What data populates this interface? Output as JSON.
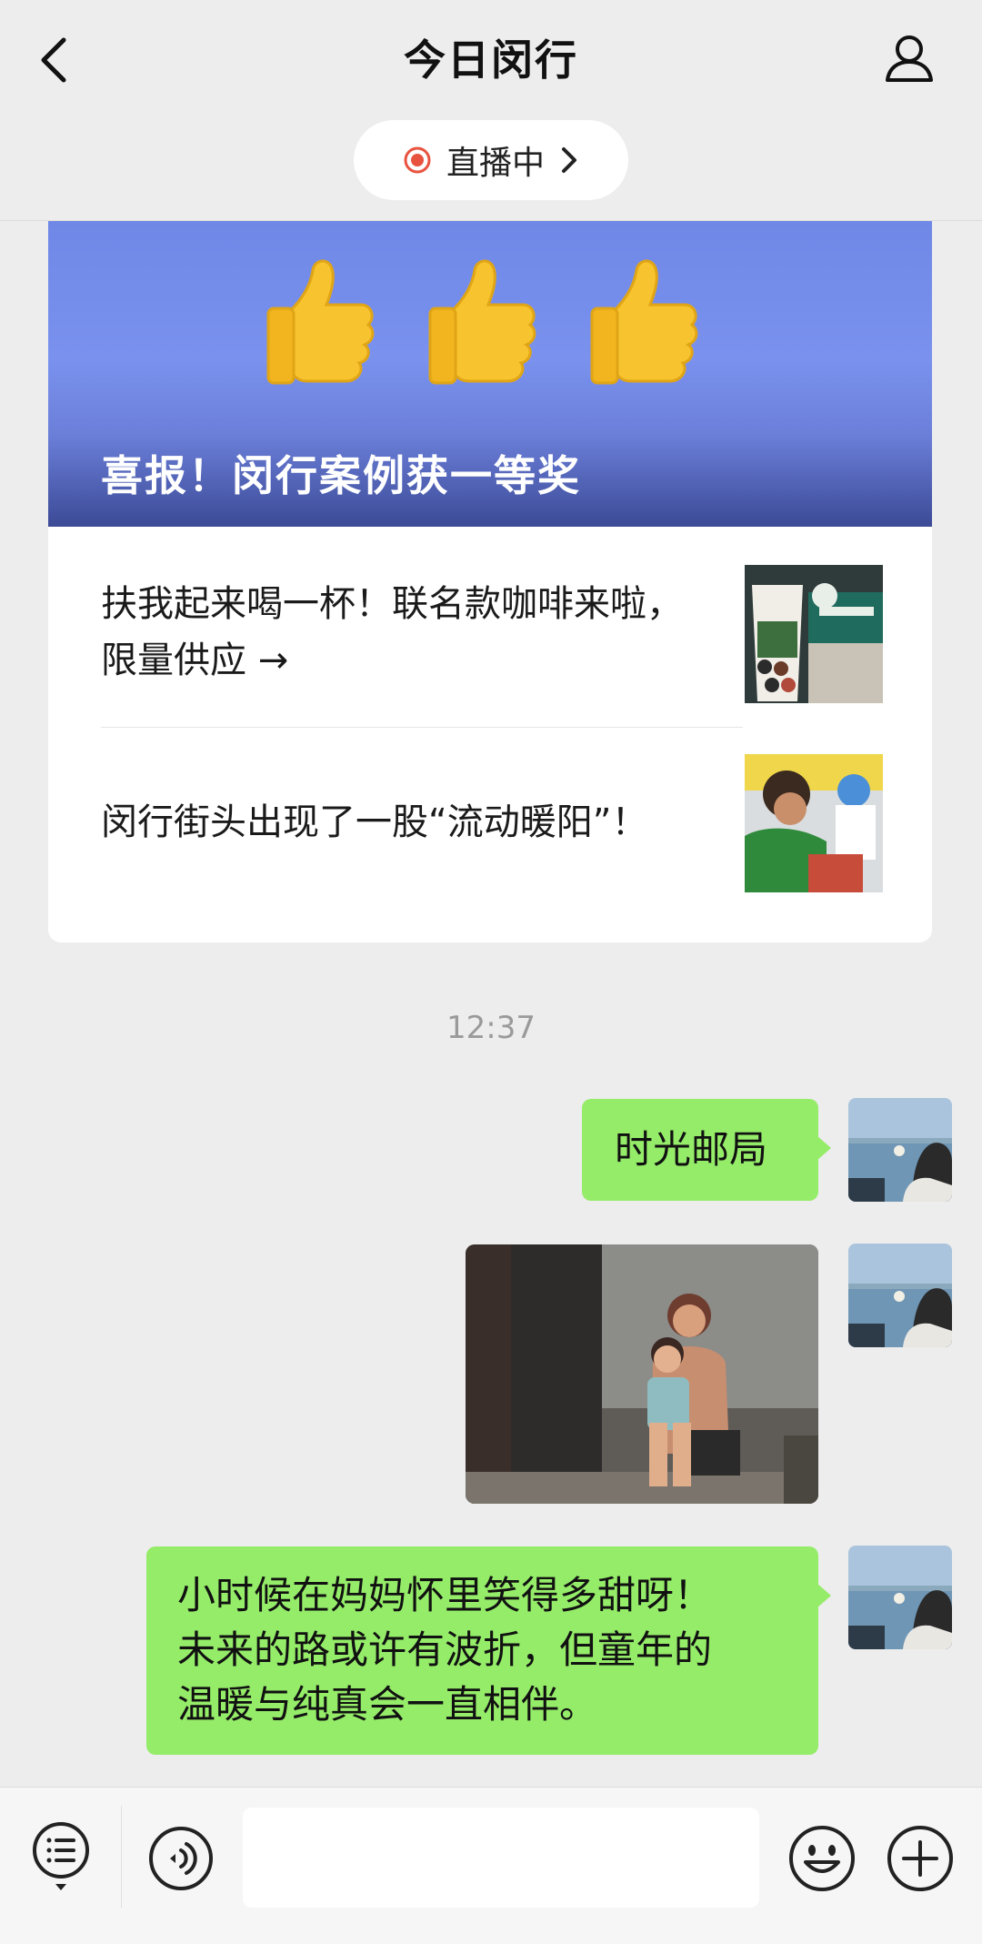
{
  "header": {
    "title": "今日闵行"
  },
  "live": {
    "label": "直播中"
  },
  "card": {
    "banner_title": "喜报！闵行案例获一等奖",
    "articles": [
      {
        "title": "扶我起来喝一杯！联名款咖啡来啦，限量供应 →"
      },
      {
        "title": "闵行街头出现了一股“流动暖阳”！"
      }
    ]
  },
  "chat": {
    "timestamp": "12:37",
    "messages": [
      {
        "type": "text",
        "text": "时光邮局"
      },
      {
        "type": "image"
      },
      {
        "type": "text",
        "text": "小时候在妈妈怀里笑得多甜呀！\n未来的路或许有波折，但童年的\n温暖与纯真会一直相伴。"
      }
    ]
  },
  "input": {
    "placeholder": ""
  },
  "colors": {
    "bubble_green": "#95ec69",
    "background": "#ededed",
    "live_red": "#e8533f",
    "banner_blue": "#7a92ee"
  },
  "icons": [
    "back-icon",
    "profile-icon",
    "live-dot-icon",
    "chevron-right-icon",
    "menu-list-icon",
    "voice-icon",
    "emoji-icon",
    "plus-icon",
    "thumbs-up-icon"
  ]
}
